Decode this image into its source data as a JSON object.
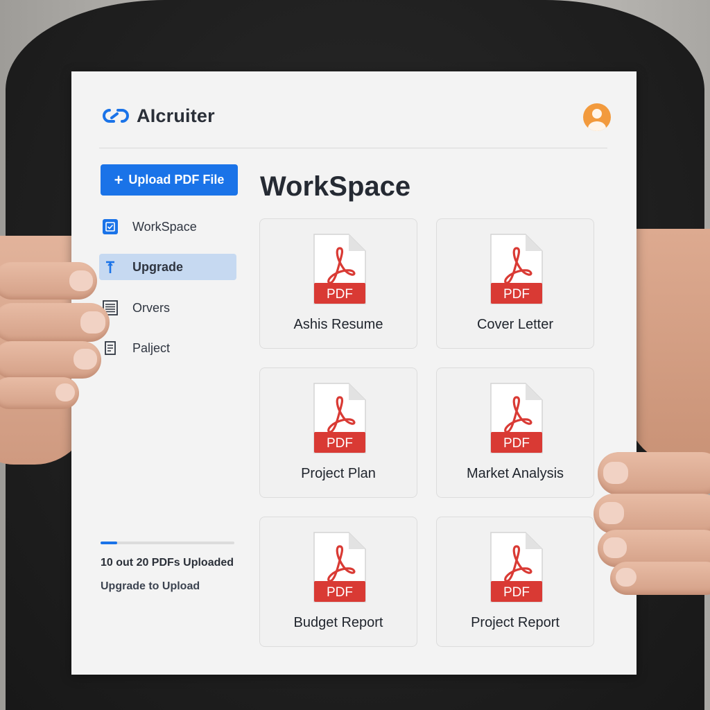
{
  "app": {
    "brand": "AIcruiter"
  },
  "sidebar": {
    "upload_label": "Upload PDF File",
    "items": [
      {
        "label": "WorkSpace",
        "icon": "workspace-icon",
        "active": false
      },
      {
        "label": "Upgrade",
        "icon": "upgrade-icon",
        "active": true
      },
      {
        "label": "Orvers",
        "icon": "list-icon",
        "active": false
      },
      {
        "label": "Palject",
        "icon": "document-icon",
        "active": false
      }
    ],
    "usage": {
      "uploaded": 10,
      "limit": 20,
      "fraction": 0.125,
      "text": "10 out 20 PDFs Uploaded"
    },
    "upgrade_link": "Upgrade to Upload"
  },
  "main": {
    "title": "WorkSpace",
    "files": [
      {
        "name": "Ashis Resume",
        "type": "PDF"
      },
      {
        "name": "Cover Letter",
        "type": "PDF"
      },
      {
        "name": "Project Plan",
        "type": "PDF"
      },
      {
        "name": "Market Analysis",
        "type": "PDF"
      },
      {
        "name": "Budget Report",
        "type": "PDF"
      },
      {
        "name": "Project Report",
        "type": "PDF"
      }
    ]
  },
  "colors": {
    "accent": "#1a73e8",
    "pdf_red": "#d93a34",
    "active_bg": "#c6d9f1",
    "avatar": "#f29a3d"
  }
}
